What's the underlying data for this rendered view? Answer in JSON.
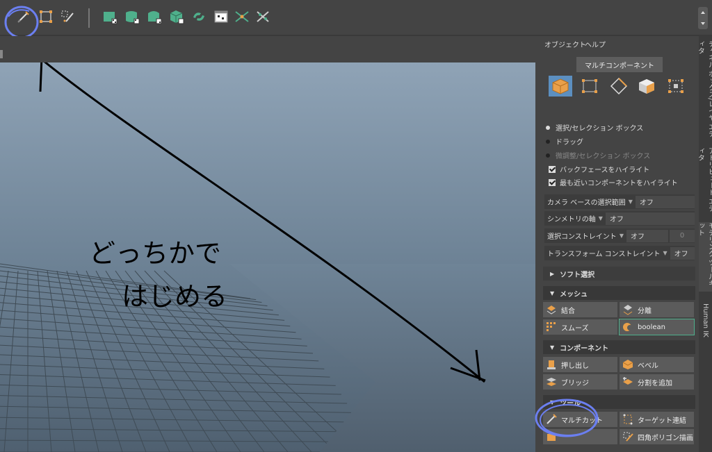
{
  "toolbar": {
    "icons": [
      "select-tool-icon",
      "lasso-tool-icon",
      "paint-select-icon",
      "polygon-plane-icon",
      "polygon-cylinder-icon",
      "polygon-cone-icon",
      "polygon-cube-icon",
      "polygon-torus-icon",
      "polygon-grid-icon",
      "multi-cut-icon",
      "target-weld-icon"
    ]
  },
  "annotation": {
    "line1": "どっちかで",
    "line2": "はじめる"
  },
  "panel": {
    "menu_object": "オブジェクト",
    "menu_help": "ヘルプ",
    "mode_title": "マルチコンポーネント",
    "options": {
      "select_box": "選択/セレクション ボックス",
      "drag": "ドラッグ",
      "tweak_box": "微調整/セレクション ボックス",
      "highlight_backface": "バックフェースをハイライト",
      "highlight_nearest": "最も近いコンポーネントをハイライト"
    },
    "fields": {
      "camera_label": "カメラ ベースの選択範囲",
      "camera_value": "オフ",
      "symmetry_label": "シンメトリの軸",
      "symmetry_value": "オフ",
      "constraint_label": "選択コンストレイント",
      "constraint_value": "オフ",
      "constraint_num": "0",
      "transform_label": "トランスフォーム コンストレイント",
      "transform_value": "オフ"
    },
    "sections": {
      "soft": "ソフト選択",
      "mesh": "メッシュ",
      "component": "コンポーネント",
      "tool": "ツール"
    },
    "mesh_tools": {
      "combine": "結合",
      "separate": "分離",
      "smooth": "スムーズ",
      "boolean": "boolean"
    },
    "component_tools": {
      "extrude": "押し出し",
      "bevel": "ベベル",
      "bridge": "ブリッジ",
      "add_divisions": "分割を追加"
    },
    "tool_tools": {
      "multicut": "マルチカット",
      "target_weld": "ターゲット連結",
      "quad_draw": "四角ポリゴン描画"
    }
  },
  "side_tabs": {
    "channel_box": "チャネル ボックス/レイヤ エディタ",
    "attribute_editor": "アトリビュート エディタ",
    "modeling_toolkit": "モデリング ツールキット",
    "human_ik": "Human IK"
  }
}
